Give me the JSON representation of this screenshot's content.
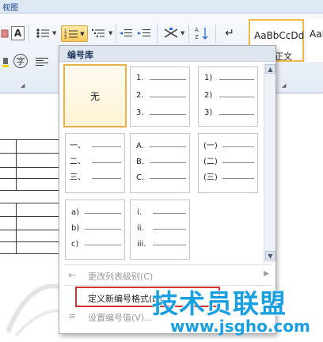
{
  "ribbon": {
    "tab_view": "视图",
    "style_sample": "AaBbCcDd",
    "style_sample_2": "AaBl",
    "style_name": "正文",
    "strikethrough_label": "A",
    "phonetic_label": "字"
  },
  "dropdown": {
    "title": "编号库",
    "tile_none_label": "无",
    "tiles": [
      {
        "markers": [
          "1.",
          "2.",
          "3."
        ]
      },
      {
        "markers": [
          "1)",
          "2)",
          "3)"
        ]
      },
      {
        "markers": [
          "一、",
          "二、",
          "三、"
        ]
      },
      {
        "markers": [
          "A.",
          "B.",
          "C."
        ]
      },
      {
        "markers": [
          "(一)",
          "(二)",
          "(三)"
        ]
      },
      {
        "markers": [
          "a)",
          "b)",
          "c)"
        ]
      },
      {
        "markers": [
          "i.",
          "ii.",
          "iii."
        ]
      }
    ],
    "menu": {
      "change_level": "更改列表级别(C)",
      "define_new": "定义新编号格式(D)...",
      "set_value": "设置编号值(V)..."
    }
  },
  "watermark": {
    "brand": "技术员联盟",
    "url": "www.jsgho.com"
  }
}
